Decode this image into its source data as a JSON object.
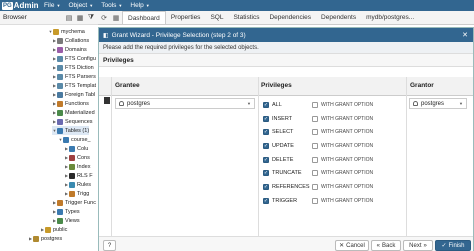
{
  "app": {
    "logo_pg": "PG",
    "logo_admin": "Admin",
    "menu": [
      "File",
      "Object",
      "Tools",
      "Help"
    ]
  },
  "browser": {
    "title": "Browser",
    "tree": [
      {
        "label": "mychema",
        "expand": "▼",
        "color": "#c79a2a"
      },
      {
        "label": "Collations",
        "expand": "▶",
        "color": "#7a7a7a"
      },
      {
        "label": "Domains",
        "expand": "▶",
        "color": "#9a5da8"
      },
      {
        "label": "FTS Configu",
        "expand": "▶",
        "color": "#5a8aa8"
      },
      {
        "label": "FTS Diction",
        "expand": "▶",
        "color": "#5a8aa8"
      },
      {
        "label": "FTS Parsers",
        "expand": "▶",
        "color": "#5a8aa8"
      },
      {
        "label": "FTS Templat",
        "expand": "▶",
        "color": "#5a8aa8"
      },
      {
        "label": "Foreign Tabl",
        "expand": "▶",
        "color": "#4a7aa0"
      },
      {
        "label": "Functions",
        "expand": "▶",
        "color": "#c07a2a"
      },
      {
        "label": "Materialized",
        "expand": "▶",
        "color": "#4a8a4a"
      },
      {
        "label": "Sequences",
        "expand": "▶",
        "color": "#6a6ab0"
      },
      {
        "label": "Tables (1)",
        "expand": "▼",
        "color": "#3a7ab0"
      },
      {
        "label": "course_",
        "expand": "▼",
        "color": "#3a7ab0"
      },
      {
        "label": "Colu",
        "expand": "▶",
        "color": "#3a7ab0"
      },
      {
        "label": "Cons",
        "expand": "▶",
        "color": "#a04040"
      },
      {
        "label": "Index",
        "expand": "▶",
        "color": "#6a8a3a"
      },
      {
        "label": "RLS F",
        "expand": "▶",
        "color": "#2a2a2a"
      },
      {
        "label": "Rules",
        "expand": "▶",
        "color": "#3a8ab0"
      },
      {
        "label": "Trigg",
        "expand": "▶",
        "color": "#c07a2a"
      },
      {
        "label": "Trigger Func",
        "expand": "▶",
        "color": "#c07a2a"
      },
      {
        "label": "Types",
        "expand": "▶",
        "color": "#3a7ab0"
      },
      {
        "label": "Views",
        "expand": "▶",
        "color": "#4a8a4a"
      },
      {
        "label": "public",
        "expand": "▶",
        "color": "#c79a2a"
      },
      {
        "label": "postgres",
        "expand": "▶",
        "color": "#b08a30"
      }
    ]
  },
  "tabs": [
    {
      "label": "Dashboard",
      "active": true
    },
    {
      "label": "Properties",
      "active": false
    },
    {
      "label": "SQL",
      "active": false
    },
    {
      "label": "Statistics",
      "active": false
    },
    {
      "label": "Dependencies",
      "active": false
    },
    {
      "label": "Dependents",
      "active": false
    },
    {
      "label": "mydb/postgres...",
      "active": false
    }
  ],
  "dialog": {
    "title": "Grant Wizard - Privilege Selection (step 2 of 3)",
    "subtitle": "Please add the required privileges for the selected objects.",
    "section": "Privileges",
    "columns": {
      "grantee": "Grantee",
      "privileges": "Privileges",
      "grantor": "Grantor"
    },
    "grantee": "postgres",
    "grantor": "postgres",
    "with_grant_label": "WITH GRANT OPTION",
    "privileges": [
      {
        "name": "ALL",
        "checked": true,
        "with_grant": false
      },
      {
        "name": "INSERT",
        "checked": true,
        "with_grant": false
      },
      {
        "name": "SELECT",
        "checked": true,
        "with_grant": false
      },
      {
        "name": "UPDATE",
        "checked": true,
        "with_grant": false
      },
      {
        "name": "DELETE",
        "checked": true,
        "with_grant": false
      },
      {
        "name": "TRUNCATE",
        "checked": true,
        "with_grant": false
      },
      {
        "name": "REFERENCES",
        "checked": true,
        "with_grant": false
      },
      {
        "name": "TRIGGER",
        "checked": true,
        "with_grant": false
      }
    ],
    "buttons": {
      "help": "?",
      "cancel": "Cancel",
      "back": "Back",
      "next": "Next",
      "finish": "Finish"
    }
  },
  "colors": {
    "primary": "#326690",
    "header_bg": "#f2f2f2",
    "selection": "#dde8f4"
  }
}
